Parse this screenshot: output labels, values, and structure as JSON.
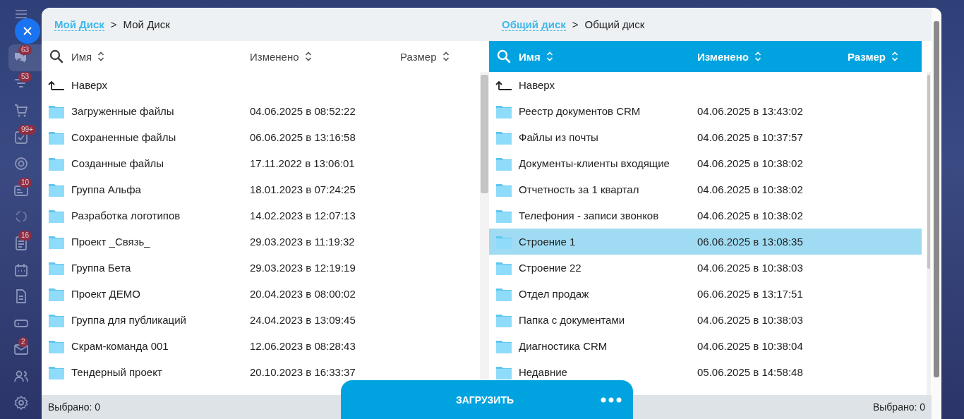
{
  "sidebar": {
    "items": [
      {
        "kind": "chat",
        "badge": "63",
        "selected": true
      },
      {
        "kind": "filter",
        "badge": "53",
        "selected": false
      },
      {
        "kind": "cart",
        "selected": false
      },
      {
        "kind": "check",
        "badge": "99+",
        "selected": false
      },
      {
        "kind": "target",
        "selected": false
      },
      {
        "kind": "card",
        "badge": "10",
        "selected": false
      },
      {
        "kind": "cycle",
        "selected": false
      },
      {
        "kind": "list",
        "badge": "16",
        "selected": false
      },
      {
        "kind": "calendar",
        "selected": false
      },
      {
        "kind": "doc",
        "selected": false
      },
      {
        "kind": "drive",
        "selected": false
      },
      {
        "kind": "mail",
        "badge": "2",
        "selected": false
      },
      {
        "kind": "people",
        "selected": false
      },
      {
        "kind": "gear",
        "selected": false
      }
    ]
  },
  "panes": [
    {
      "breadcrumb": {
        "link": "Мой Диск",
        "separator": ">",
        "current": "Мой Диск"
      },
      "active": false,
      "columns": [
        "Имя",
        "Изменено",
        "Размер"
      ],
      "up_label": "Наверх",
      "rows": [
        {
          "name": "Загруженные файлы",
          "modified": "04.06.2025 в 08:52:22",
          "selected": false
        },
        {
          "name": "Сохраненные файлы",
          "modified": "06.06.2025 в 13:16:58",
          "selected": false
        },
        {
          "name": "Созданные файлы",
          "modified": "17.11.2022 в 13:06:01",
          "selected": false
        },
        {
          "name": "Группа Альфа",
          "modified": "18.01.2023 в 07:24:25",
          "selected": false
        },
        {
          "name": "Разработка логотипов",
          "modified": "14.02.2023 в 12:07:13",
          "selected": false
        },
        {
          "name": "Проект _Связь_",
          "modified": "29.03.2023 в 11:19:32",
          "selected": false
        },
        {
          "name": "Группа Бета",
          "modified": "29.03.2023 в 12:19:19",
          "selected": false
        },
        {
          "name": "Проект ДЕМО",
          "modified": "20.04.2023 в 08:00:02",
          "selected": false
        },
        {
          "name": "Группа для публикаций",
          "modified": "24.04.2023 в 13:09:45",
          "selected": false
        },
        {
          "name": "Скрам-команда 001",
          "modified": "12.06.2023 в 08:28:43",
          "selected": false
        },
        {
          "name": "Тендерный проект",
          "modified": "20.10.2023 в 16:33:37",
          "selected": false
        }
      ],
      "footer": "Выбрано: 0"
    },
    {
      "breadcrumb": {
        "link": "Общий диск",
        "separator": ">",
        "current": "Общий диск"
      },
      "active": true,
      "columns": [
        "Имя",
        "Изменено",
        "Размер"
      ],
      "up_label": "Наверх",
      "rows": [
        {
          "name": "Реестр документов CRM",
          "modified": "04.06.2025 в 13:43:02",
          "selected": false
        },
        {
          "name": "Файлы из почты",
          "modified": "04.06.2025 в 10:37:57",
          "selected": false
        },
        {
          "name": "Документы-клиенты входящие",
          "modified": "04.06.2025 в 10:38:02",
          "selected": false
        },
        {
          "name": "Отчетность за 1 квартал",
          "modified": "04.06.2025 в 10:38:02",
          "selected": false
        },
        {
          "name": "Телефония - записи звонков",
          "modified": "04.06.2025 в 10:38:02",
          "selected": false
        },
        {
          "name": "Строение 1",
          "modified": "06.06.2025 в 13:08:35",
          "selected": true
        },
        {
          "name": "Строение 22",
          "modified": "04.06.2025 в 10:38:03",
          "selected": false
        },
        {
          "name": "Отдел продаж",
          "modified": "06.06.2025 в 13:17:51",
          "selected": false
        },
        {
          "name": "Папка с документами",
          "modified": "04.06.2025 в 10:38:03",
          "selected": false
        },
        {
          "name": "Диагностика CRM",
          "modified": "04.06.2025 в 10:38:04",
          "selected": false
        },
        {
          "name": "Недавние",
          "modified": "05.06.2025 в 14:58:48",
          "selected": false
        }
      ],
      "footer": "Выбрано: 0"
    }
  ],
  "upload_button": {
    "label": "ЗАГРУЗИТЬ"
  }
}
